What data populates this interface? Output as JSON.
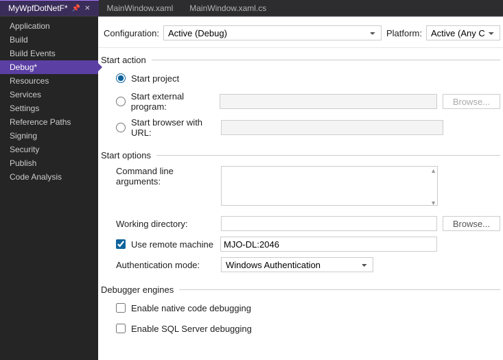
{
  "tabs": {
    "t0": "MyWpfDotNetF*",
    "t1": "MainWindow.xaml",
    "t2": "MainWindow.xaml.cs"
  },
  "sidebar": {
    "items": [
      "Application",
      "Build",
      "Build Events",
      "Debug*",
      "Resources",
      "Services",
      "Settings",
      "Reference Paths",
      "Signing",
      "Security",
      "Publish",
      "Code Analysis"
    ]
  },
  "topbar": {
    "config_label": "Configuration:",
    "config_value": "Active (Debug)",
    "platform_label": "Platform:",
    "platform_value": "Active (Any CPU)"
  },
  "sections": {
    "start_action": {
      "title": "Start action",
      "start_project": "Start project",
      "start_external": "Start external program:",
      "start_browser": "Start browser with URL:",
      "browse": "Browse..."
    },
    "start_options": {
      "title": "Start options",
      "cli_args": "Command line arguments:",
      "workdir": "Working directory:",
      "browse": "Browse...",
      "remote": "Use remote machine",
      "remote_value": "MJO-DL:2046",
      "auth_mode": "Authentication mode:",
      "auth_value": "Windows Authentication"
    },
    "debugger": {
      "title": "Debugger engines",
      "native": "Enable native code debugging",
      "sql": "Enable SQL Server debugging"
    }
  }
}
